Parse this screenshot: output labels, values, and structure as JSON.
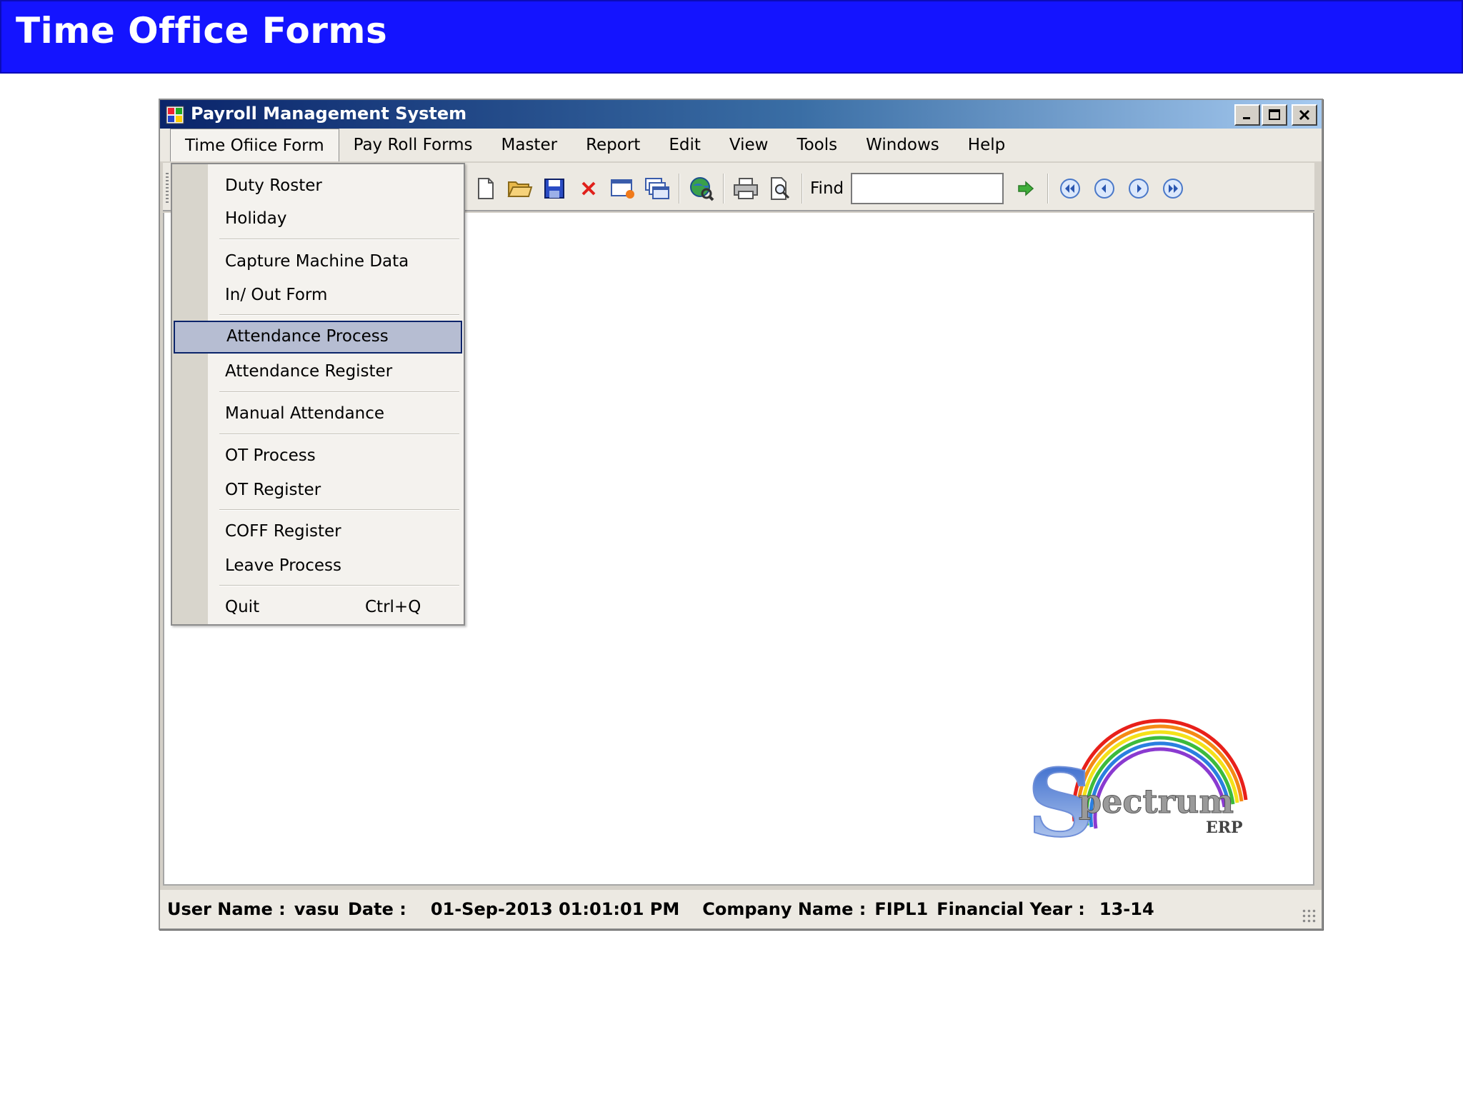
{
  "slide": {
    "title": "Time Office Forms"
  },
  "window": {
    "title": "Payroll Management System"
  },
  "menubar": {
    "items": [
      "Time Ofiice Form",
      "Pay Roll Forms",
      "Master",
      "Report",
      "Edit",
      "View",
      "Tools",
      "Windows",
      "Help"
    ],
    "open_index": 0
  },
  "toolbar": {
    "find_label": "Find",
    "find_value": "",
    "icons": [
      "new-icon",
      "open-folder-icon",
      "save-icon",
      "delete-icon",
      "window-icon",
      "cascade-icon",
      "globe-search-icon",
      "print-icon",
      "print-preview-icon",
      "go-arrow-icon",
      "first-record-icon",
      "previous-record-icon",
      "next-record-icon",
      "last-record-icon"
    ]
  },
  "dropdown": {
    "items": [
      {
        "label": "Duty Roster",
        "shortcut": ""
      },
      {
        "label": "Holiday",
        "shortcut": ""
      },
      {
        "label": "Capture Machine Data",
        "shortcut": ""
      },
      {
        "label": "In/ Out Form",
        "shortcut": ""
      },
      {
        "label": "Attendance Process",
        "shortcut": "",
        "highlighted": true
      },
      {
        "label": "Attendance Register",
        "shortcut": ""
      },
      {
        "label": "Manual Attendance",
        "shortcut": ""
      },
      {
        "label": "OT Process",
        "shortcut": ""
      },
      {
        "label": "OT Register",
        "shortcut": ""
      },
      {
        "label": "COFF Register",
        "shortcut": ""
      },
      {
        "label": "Leave Process",
        "shortcut": ""
      },
      {
        "label": "Quit",
        "shortcut": "Ctrl+Q"
      }
    ]
  },
  "statusbar": {
    "user_label": "User Name :",
    "user_value": "vasu",
    "date_label": "Date :",
    "date_value": "01-Sep-2013 01:01:01 PM",
    "company_label": "Company Name :",
    "company_value": "FIPL1",
    "fy_label": "Financial Year :",
    "fy_value": "13-14"
  },
  "logo": {
    "main": "pectrum",
    "sub": "ERP",
    "initial": "S"
  },
  "colors": {
    "slide_header": "#1414ff",
    "titlebar_start": "#0a246a",
    "titlebar_end": "#a6caf0",
    "highlight": "#b6bdd2"
  }
}
